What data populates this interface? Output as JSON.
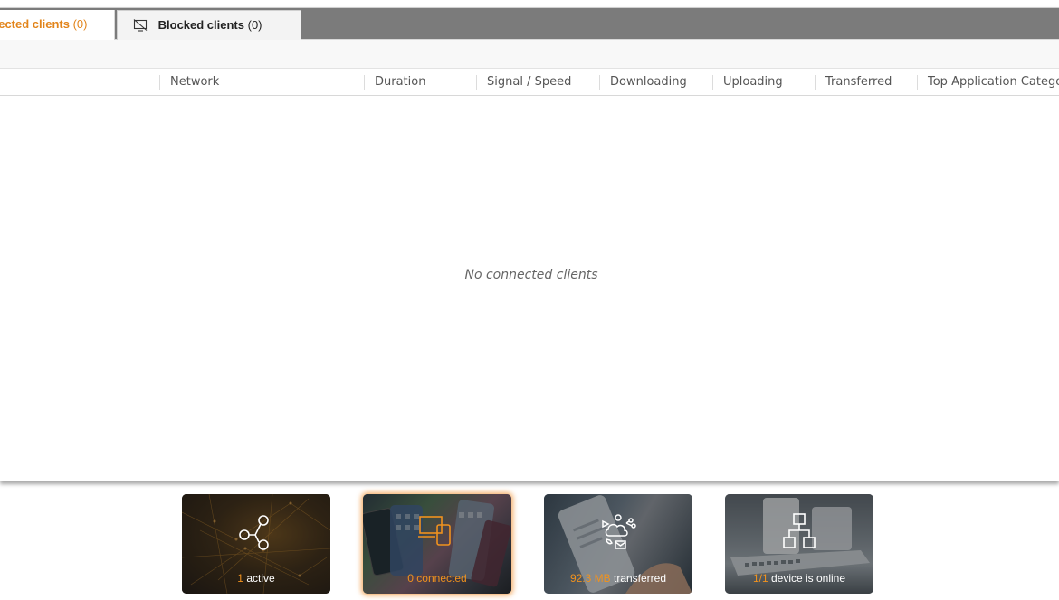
{
  "tabs": {
    "connected": {
      "label": "Connected clients",
      "count": "(0)"
    },
    "blocked": {
      "label": "Blocked clients",
      "count": "(0)"
    }
  },
  "table": {
    "columns": [
      "Network",
      "Duration",
      "Signal / Speed",
      "Downloading",
      "Uploading",
      "Transferred",
      "Top Application Category"
    ],
    "empty_message": "No connected clients"
  },
  "cards": {
    "networks": {
      "number": "1",
      "text": "active",
      "icon": "network-share-icon"
    },
    "clients": {
      "number": "0 connected",
      "text": "",
      "icon": "devices-icon"
    },
    "apps": {
      "number": "92.3 MB",
      "text": "transferred",
      "icon": "apps-cloud-icon"
    },
    "devices": {
      "number": "1/1",
      "text": "device is online",
      "icon": "network-topology-icon"
    }
  },
  "colors": {
    "accent": "#e2841a",
    "tabbar": "#7b7b7b"
  }
}
